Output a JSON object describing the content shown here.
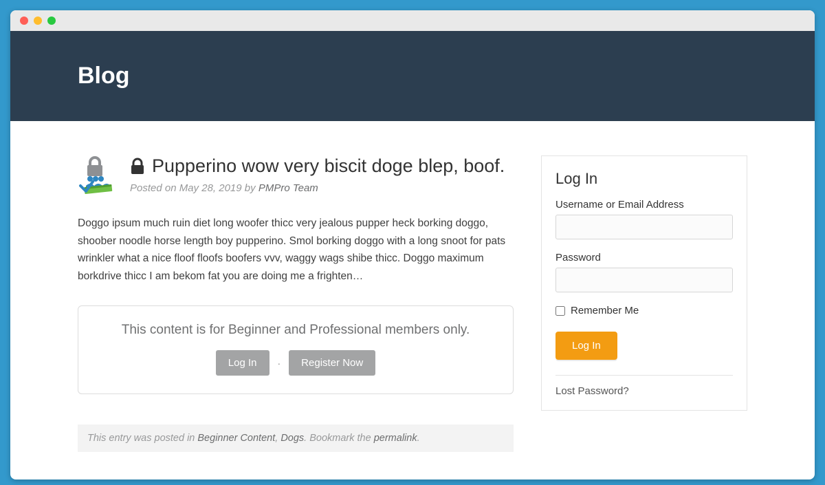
{
  "hero": {
    "title": "Blog"
  },
  "post": {
    "title": "Pupperino wow very biscit doge blep, boof.",
    "meta_prefix": "Posted on ",
    "date": "May 28, 2019",
    "meta_by": " by ",
    "author": "PMPro Team",
    "excerpt": "Doggo ipsum much ruin diet long woofer thicc very jealous pupper heck borking doggo, shoober noodle horse length boy pupperino. Smol borking doggo with a long snoot for pats wrinkler what a nice floof floofs boofers vvv, waggy wags shibe thicc. Doggo maximum borkdrive thicc I am bekom fat you are doing me a frighten…"
  },
  "restrict": {
    "message": "This content is for Beginner and Professional members only.",
    "login_label": "Log In",
    "separator": "·",
    "register_label": "Register Now"
  },
  "entry_footer": {
    "prefix": "This entry was posted in ",
    "cat1": "Beginner Content",
    "sep": ", ",
    "cat2": "Dogs",
    "middle": ". Bookmark the ",
    "permalink": "permalink",
    "suffix": "."
  },
  "login_widget": {
    "heading": "Log In",
    "username_label": "Username or Email Address",
    "password_label": "Password",
    "remember_label": "Remember Me",
    "submit_label": "Log In",
    "lost_password": "Lost Password?"
  }
}
